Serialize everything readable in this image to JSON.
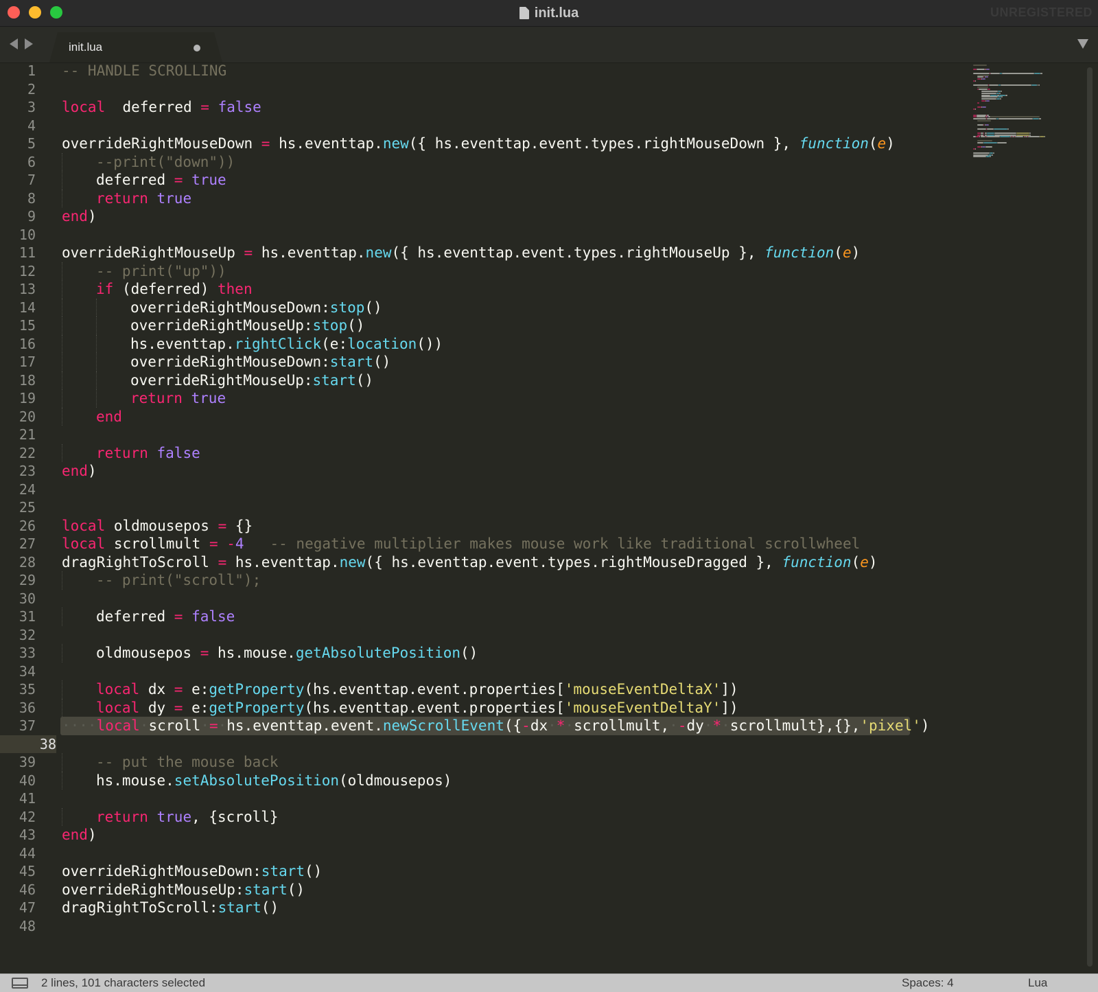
{
  "window": {
    "title": "init.lua",
    "watermark": "UNREGISTERED"
  },
  "tabs": [
    {
      "label": "init.lua",
      "modified": true
    }
  ],
  "editor": {
    "current_line": 38,
    "lines": [
      {
        "n": "1",
        "indent": 0,
        "tokens": [
          [
            "cmt",
            "-- HANDLE SCROLLING"
          ]
        ]
      },
      {
        "n": "2",
        "indent": 0,
        "tokens": []
      },
      {
        "n": "3",
        "indent": 0,
        "tokens": [
          [
            "kw",
            "local"
          ],
          [
            "",
            "  deferred "
          ],
          [
            "op",
            "="
          ],
          [
            "",
            " "
          ],
          [
            "bool",
            "false"
          ]
        ]
      },
      {
        "n": "4",
        "indent": 0,
        "tokens": []
      },
      {
        "n": "5",
        "indent": 0,
        "tokens": [
          [
            "",
            "overrideRightMouseDown "
          ],
          [
            "op",
            "="
          ],
          [
            "",
            " hs.eventtap."
          ],
          [
            "fn",
            "new"
          ],
          [
            "",
            "({ hs.eventtap.event.types.rightMouseDown }, "
          ],
          [
            "func",
            "function"
          ],
          [
            "",
            "("
          ],
          [
            "param",
            "e"
          ],
          [
            "",
            ")"
          ]
        ]
      },
      {
        "n": "6",
        "indent": 1,
        "tokens": [
          [
            "cmt",
            "--print(\"down\"))"
          ]
        ]
      },
      {
        "n": "7",
        "indent": 1,
        "tokens": [
          [
            "",
            "deferred "
          ],
          [
            "op",
            "="
          ],
          [
            "",
            " "
          ],
          [
            "bool",
            "true"
          ]
        ]
      },
      {
        "n": "8",
        "indent": 1,
        "tokens": [
          [
            "kw",
            "return"
          ],
          [
            "",
            " "
          ],
          [
            "bool",
            "true"
          ]
        ]
      },
      {
        "n": "9",
        "indent": 0,
        "tokens": [
          [
            "kw",
            "end"
          ],
          [
            "",
            ")"
          ]
        ]
      },
      {
        "n": "10",
        "indent": 0,
        "tokens": []
      },
      {
        "n": "11",
        "indent": 0,
        "tokens": [
          [
            "",
            "overrideRightMouseUp "
          ],
          [
            "op",
            "="
          ],
          [
            "",
            " hs.eventtap."
          ],
          [
            "fn",
            "new"
          ],
          [
            "",
            "({ hs.eventtap.event.types.rightMouseUp }, "
          ],
          [
            "func",
            "function"
          ],
          [
            "",
            "("
          ],
          [
            "param",
            "e"
          ],
          [
            "",
            ")"
          ]
        ]
      },
      {
        "n": "12",
        "indent": 1,
        "tokens": [
          [
            "cmt",
            "-- print(\"up\"))"
          ]
        ]
      },
      {
        "n": "13",
        "indent": 1,
        "tokens": [
          [
            "kw",
            "if"
          ],
          [
            "",
            " (deferred) "
          ],
          [
            "kw",
            "then"
          ]
        ]
      },
      {
        "n": "14",
        "indent": 2,
        "tokens": [
          [
            "",
            "overrideRightMouseDown:"
          ],
          [
            "fn",
            "stop"
          ],
          [
            "",
            "()"
          ]
        ]
      },
      {
        "n": "15",
        "indent": 2,
        "tokens": [
          [
            "",
            "overrideRightMouseUp:"
          ],
          [
            "fn",
            "stop"
          ],
          [
            "",
            "()"
          ]
        ]
      },
      {
        "n": "16",
        "indent": 2,
        "tokens": [
          [
            "",
            "hs.eventtap."
          ],
          [
            "fn",
            "rightClick"
          ],
          [
            "",
            "(e:"
          ],
          [
            "fn",
            "location"
          ],
          [
            "",
            "())"
          ]
        ]
      },
      {
        "n": "17",
        "indent": 2,
        "tokens": [
          [
            "",
            "overrideRightMouseDown:"
          ],
          [
            "fn",
            "start"
          ],
          [
            "",
            "()"
          ]
        ]
      },
      {
        "n": "18",
        "indent": 2,
        "tokens": [
          [
            "",
            "overrideRightMouseUp:"
          ],
          [
            "fn",
            "start"
          ],
          [
            "",
            "()"
          ]
        ]
      },
      {
        "n": "19",
        "indent": 2,
        "tokens": [
          [
            "kw",
            "return"
          ],
          [
            "",
            " "
          ],
          [
            "bool",
            "true"
          ]
        ]
      },
      {
        "n": "20",
        "indent": 1,
        "tokens": [
          [
            "kw",
            "end"
          ]
        ]
      },
      {
        "n": "21",
        "indent": 0,
        "tokens": []
      },
      {
        "n": "22",
        "indent": 1,
        "tokens": [
          [
            "kw",
            "return"
          ],
          [
            "",
            " "
          ],
          [
            "bool",
            "false"
          ]
        ]
      },
      {
        "n": "23",
        "indent": 0,
        "tokens": [
          [
            "kw",
            "end"
          ],
          [
            "",
            ")"
          ]
        ]
      },
      {
        "n": "24",
        "indent": 0,
        "tokens": []
      },
      {
        "n": "25",
        "indent": 0,
        "tokens": []
      },
      {
        "n": "26",
        "indent": 0,
        "tokens": [
          [
            "kw",
            "local"
          ],
          [
            "",
            " oldmousepos "
          ],
          [
            "op",
            "="
          ],
          [
            "",
            " {}"
          ]
        ]
      },
      {
        "n": "27",
        "indent": 0,
        "tokens": [
          [
            "kw",
            "local"
          ],
          [
            "",
            " scrollmult "
          ],
          [
            "op",
            "="
          ],
          [
            "",
            " "
          ],
          [
            "op",
            "-"
          ],
          [
            "num",
            "4"
          ],
          [
            "",
            "   "
          ],
          [
            "cmt",
            "-- negative multiplier makes mouse work like traditional scrollwheel"
          ]
        ]
      },
      {
        "n": "28",
        "indent": 0,
        "tokens": [
          [
            "",
            "dragRightToScroll "
          ],
          [
            "op",
            "="
          ],
          [
            "",
            " hs.eventtap."
          ],
          [
            "fn",
            "new"
          ],
          [
            "",
            "({ hs.eventtap.event.types.rightMouseDragged }, "
          ],
          [
            "func",
            "function"
          ],
          [
            "",
            "("
          ],
          [
            "param",
            "e"
          ],
          [
            "",
            ")"
          ]
        ]
      },
      {
        "n": "29",
        "indent": 1,
        "tokens": [
          [
            "cmt",
            "-- print(\"scroll\");"
          ]
        ]
      },
      {
        "n": "30",
        "indent": 0,
        "tokens": []
      },
      {
        "n": "31",
        "indent": 1,
        "tokens": [
          [
            "",
            "deferred "
          ],
          [
            "op",
            "="
          ],
          [
            "",
            " "
          ],
          [
            "bool",
            "false"
          ]
        ]
      },
      {
        "n": "32",
        "indent": 0,
        "tokens": []
      },
      {
        "n": "33",
        "indent": 1,
        "tokens": [
          [
            "",
            "oldmousepos "
          ],
          [
            "op",
            "="
          ],
          [
            "",
            " hs.mouse."
          ],
          [
            "fn",
            "getAbsolutePosition"
          ],
          [
            "",
            "()"
          ]
        ]
      },
      {
        "n": "34",
        "indent": 0,
        "tokens": []
      },
      {
        "n": "35",
        "indent": 1,
        "tokens": [
          [
            "kw",
            "local"
          ],
          [
            "",
            " dx "
          ],
          [
            "op",
            "="
          ],
          [
            "",
            " e:"
          ],
          [
            "fn",
            "getProperty"
          ],
          [
            "",
            "(hs.eventtap.event.properties["
          ],
          [
            "str",
            "'mouseEventDeltaX'"
          ],
          [
            "",
            "])"
          ]
        ]
      },
      {
        "n": "36",
        "indent": 1,
        "tokens": [
          [
            "kw",
            "local"
          ],
          [
            "",
            " dy "
          ],
          [
            "op",
            "="
          ],
          [
            "",
            " e:"
          ],
          [
            "fn",
            "getProperty"
          ],
          [
            "",
            "(hs.eventtap.event.properties["
          ],
          [
            "str",
            "'mouseEventDeltaY'"
          ],
          [
            "",
            "])"
          ]
        ]
      },
      {
        "n": "37",
        "indent": 0,
        "selected": true,
        "tokens": [
          [
            "ws",
            "····"
          ],
          [
            "kw",
            "local"
          ],
          [
            "ws",
            "·"
          ],
          [
            "",
            "scroll"
          ],
          [
            "ws",
            "·"
          ],
          [
            "op",
            "="
          ],
          [
            "ws",
            "·"
          ],
          [
            "",
            "hs.eventtap.event."
          ],
          [
            "fn",
            "newScrollEvent"
          ],
          [
            "",
            "({"
          ],
          [
            "op",
            "-"
          ],
          [
            "",
            "dx"
          ],
          [
            "ws",
            "·"
          ],
          [
            "op",
            "*"
          ],
          [
            "ws",
            "·"
          ],
          [
            "",
            "scrollmult,"
          ],
          [
            "ws",
            "·"
          ],
          [
            "op",
            "-"
          ],
          [
            "",
            "dy"
          ],
          [
            "ws",
            "·"
          ],
          [
            "op",
            "*"
          ],
          [
            "ws",
            "·"
          ],
          [
            "",
            "scrollmult},{},"
          ],
          [
            "str",
            "'pixel'"
          ],
          [
            "",
            ")"
          ]
        ]
      },
      {
        "n": "38",
        "indent": 0,
        "tokens": []
      },
      {
        "n": "39",
        "indent": 1,
        "tokens": [
          [
            "cmt",
            "-- put the mouse back"
          ]
        ]
      },
      {
        "n": "40",
        "indent": 1,
        "tokens": [
          [
            "",
            "hs.mouse."
          ],
          [
            "fn",
            "setAbsolutePosition"
          ],
          [
            "",
            "(oldmousepos)"
          ]
        ]
      },
      {
        "n": "41",
        "indent": 0,
        "tokens": []
      },
      {
        "n": "42",
        "indent": 1,
        "tokens": [
          [
            "kw",
            "return"
          ],
          [
            "",
            " "
          ],
          [
            "bool",
            "true"
          ],
          [
            "",
            ", {scroll}"
          ]
        ]
      },
      {
        "n": "43",
        "indent": 0,
        "tokens": [
          [
            "kw",
            "end"
          ],
          [
            "",
            ")"
          ]
        ]
      },
      {
        "n": "44",
        "indent": 0,
        "tokens": []
      },
      {
        "n": "45",
        "indent": 0,
        "tokens": [
          [
            "",
            "overrideRightMouseDown:"
          ],
          [
            "fn",
            "start"
          ],
          [
            "",
            "()"
          ]
        ]
      },
      {
        "n": "46",
        "indent": 0,
        "tokens": [
          [
            "",
            "overrideRightMouseUp:"
          ],
          [
            "fn",
            "start"
          ],
          [
            "",
            "()"
          ]
        ]
      },
      {
        "n": "47",
        "indent": 0,
        "tokens": [
          [
            "",
            "dragRightToScroll:"
          ],
          [
            "fn",
            "start"
          ],
          [
            "",
            "()"
          ]
        ]
      },
      {
        "n": "48",
        "indent": 0,
        "tokens": []
      }
    ]
  },
  "status": {
    "selection": "2 lines, 101 characters selected",
    "spaces": "Spaces: 4",
    "syntax": "Lua"
  },
  "colors": {
    "background": "#272822",
    "keyword": "#f92672",
    "constant": "#ae81ff",
    "function": "#66d9ef",
    "parameter": "#fd971f",
    "comment": "#75715e",
    "string": "#e6db74"
  }
}
